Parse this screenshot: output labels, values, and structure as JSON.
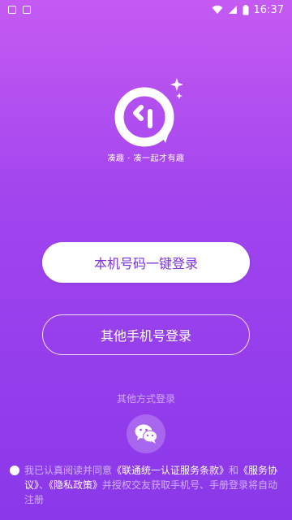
{
  "status_bar": {
    "time": "16:37",
    "left_icons": [
      "image-icon",
      "a-icon"
    ],
    "right_icons": [
      "wifi-icon",
      "signal-icon",
      "battery-icon"
    ]
  },
  "brand": {
    "slogan": "凑趣 · 凑一起才有趣",
    "logo_icon": "chat-bubble-logo-icon"
  },
  "buttons": {
    "one_key_login": "本机号码一键登录",
    "other_phone_login": "其他手机号登录"
  },
  "other_methods": {
    "label": "其他方式登录",
    "wechat_icon": "wechat-icon"
  },
  "agreement": {
    "prefix": "我已认真阅读并同意",
    "unicom_terms": "《联通统一认证服务条款》",
    "and": "和",
    "service_agreement": "《服务协议》",
    "sep": "、",
    "privacy_policy": "《隐私政策》",
    "suffix": "并授权交友获取手机号、手册登录将自动注册"
  },
  "colors": {
    "gradient_top": "#c55af2",
    "gradient_bottom": "#8a38ea",
    "primary_button_text": "#7a33d9"
  }
}
